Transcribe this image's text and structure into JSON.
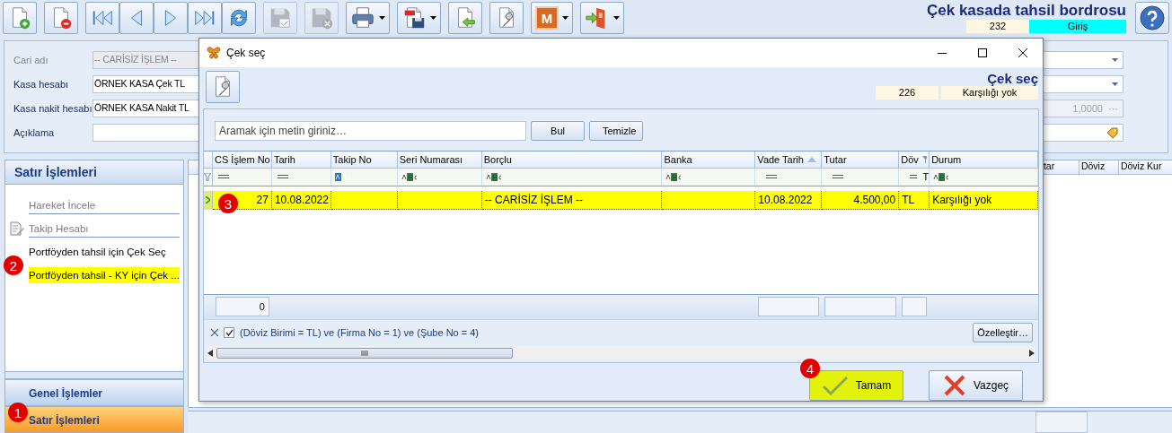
{
  "toolbar": [
    {
      "kind": "new",
      "disabled": false,
      "dropdown": false
    },
    {
      "kind": "delete",
      "disabled": false,
      "dropdown": false
    },
    {
      "kind": "first",
      "disabled": false,
      "dropdown": false
    },
    {
      "kind": "prev",
      "disabled": false,
      "dropdown": false
    },
    {
      "kind": "next",
      "disabled": false,
      "dropdown": false
    },
    {
      "kind": "last",
      "disabled": false,
      "dropdown": false
    },
    {
      "kind": "refresh",
      "disabled": false,
      "dropdown": false
    },
    {
      "kind": "save",
      "disabled": true,
      "dropdown": false
    },
    {
      "kind": "cancel-save",
      "disabled": true,
      "dropdown": false
    },
    {
      "kind": "print",
      "disabled": false,
      "dropdown": true
    },
    {
      "kind": "pdf",
      "disabled": false,
      "dropdown": true
    },
    {
      "kind": "import",
      "disabled": false,
      "dropdown": false
    },
    {
      "kind": "tools",
      "disabled": false,
      "dropdown": false
    },
    {
      "kind": "module",
      "label": "M",
      "disabled": false,
      "dropdown": true
    },
    {
      "kind": "exit",
      "disabled": false,
      "dropdown": true
    }
  ],
  "header": {
    "title": "Çek kasada tahsil bordrosu",
    "number": "232",
    "mode": "Giriş"
  },
  "form": {
    "rows": [
      {
        "label": "Cari adı",
        "value": "-- CARİSİZ İŞLEM --",
        "disabled": true,
        "side": {
          "kind": "dropdown",
          "disabled": false
        }
      },
      {
        "label": "Kasa hesabı",
        "value": "ÖRNEK KASA Çek TL",
        "disabled": false,
        "side": {
          "kind": "dropdown",
          "disabled": false
        }
      },
      {
        "label": "Kasa nakit hesabı",
        "value": "ÖRNEK KASA Nakit TL",
        "disabled": false,
        "side": {
          "kind": "number",
          "value": "1,0000",
          "button": "···",
          "disabled": true
        }
      },
      {
        "label": "Açıklama",
        "disabled": false,
        "side": {
          "kind": "tag",
          "disabled": false
        }
      }
    ]
  },
  "side_panel": {
    "title": "Satır İşlemleri",
    "items": [
      {
        "label": "Hareket İncele",
        "kind": "plain",
        "disabled": true,
        "selected": false,
        "divider": true
      },
      {
        "label": "Takip Hesabı",
        "kind": "icon",
        "disabled": true,
        "selected": false,
        "divider": true
      },
      {
        "label": "Portföyden tahsil için Çek Seç",
        "kind": "plain",
        "disabled": false,
        "selected": false,
        "divider": false
      },
      {
        "label": "Portföyden tahsil - KY için Çek ...",
        "kind": "plain",
        "disabled": false,
        "selected": true,
        "divider": false
      }
    ]
  },
  "nav_groups": [
    {
      "label": "Genel İşlemler",
      "selected": false
    },
    {
      "label": "Satır İşlemleri",
      "selected": true
    }
  ],
  "background_grid": {
    "columns": [
      "tar",
      "Döviz",
      "Döviz Kur"
    ]
  },
  "dialog": {
    "title": "Çek seç",
    "heading": "Çek seç",
    "number": "226",
    "status": "Karşılığı yok",
    "search": {
      "placeholder": "Aramak için metin giriniz…"
    },
    "search_buttons": [
      "Bul",
      "Temizle"
    ],
    "grid": {
      "columns": [
        {
          "label": "CS İşlem No",
          "kind": "number",
          "summary": true,
          "summary_value": "0"
        },
        {
          "label": "Tarih",
          "kind": "date",
          "summary": false
        },
        {
          "label": "Takip No",
          "kind": "code",
          "summary": false
        },
        {
          "label": "Seri Numarası",
          "kind": "text",
          "summary": false
        },
        {
          "label": "Borçlu",
          "kind": "text",
          "summary": false
        },
        {
          "label": "Banka",
          "kind": "text",
          "summary": false
        },
        {
          "label": "Vade Tarih",
          "kind": "date",
          "summary": true,
          "sorted": true
        },
        {
          "label": "Tutar",
          "kind": "number",
          "summary": true
        },
        {
          "label": "Döv",
          "kind": "currency",
          "filter_value": "T",
          "summary": true,
          "filtered": true
        },
        {
          "label": "Durum",
          "kind": "text",
          "summary": false
        }
      ],
      "rows": [
        {
          "selected": true,
          "cells": [
            "27",
            "10.08.2022",
            "",
            "",
            "-- CARİSİZ İŞLEM --",
            "",
            "10.08.2022",
            "4.500,00",
            "TL",
            "Karşılığı yok"
          ]
        }
      ]
    },
    "filter_bar": {
      "active": true,
      "expression": "(Döviz Birimi = TL) ve (Firma No = 1) ve (Şube No = 4)",
      "customize": "Özelleştir…"
    },
    "buttons": [
      {
        "label": "Tamam",
        "kind": "ok",
        "highlighted": true
      },
      {
        "label": "Vazgeç",
        "kind": "cancel",
        "highlighted": false
      }
    ]
  },
  "annotations": [
    {
      "label": "1"
    },
    {
      "label": "2"
    },
    {
      "label": "3"
    },
    {
      "label": "4"
    }
  ]
}
